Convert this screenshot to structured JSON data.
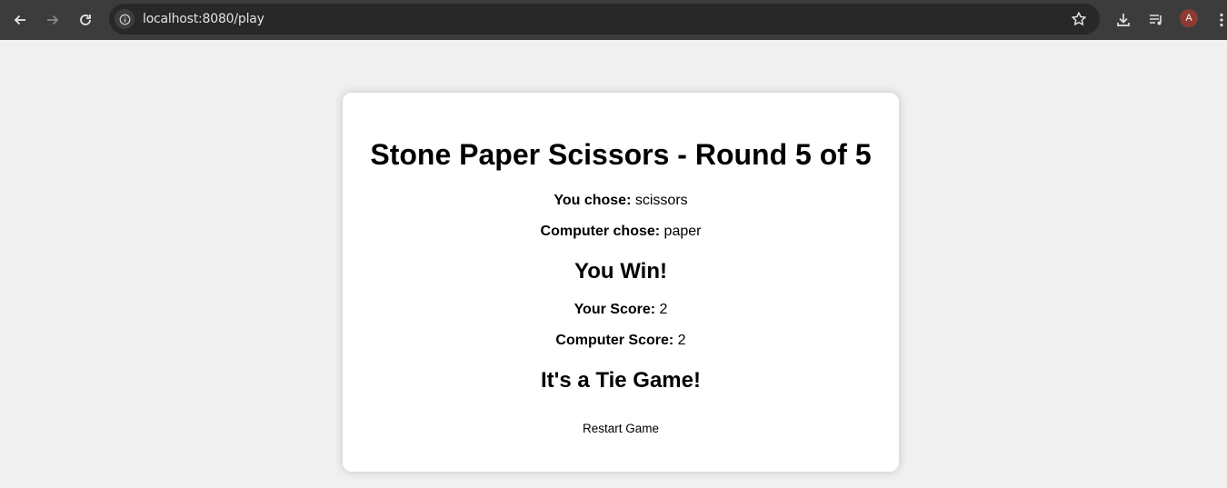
{
  "browser": {
    "url": "localhost:8080/play",
    "avatar_letter": "A",
    "icons": [
      "back-icon",
      "forward-icon",
      "reload-icon",
      "site-info-icon",
      "star-icon",
      "download-icon",
      "media-control-icon",
      "menu-icon"
    ]
  },
  "game": {
    "title": "Stone Paper Scissors - Round 5 of 5",
    "player_choice_label": "You chose:",
    "player_choice": "scissors",
    "computer_choice_label": "Computer chose:",
    "computer_choice": "paper",
    "round_result": "You Win!",
    "player_score_label": "Your Score:",
    "player_score": "2",
    "computer_score_label": "Computer Score:",
    "computer_score": "2",
    "final_result": "It's a Tie Game!",
    "restart_label": "Restart Game"
  }
}
